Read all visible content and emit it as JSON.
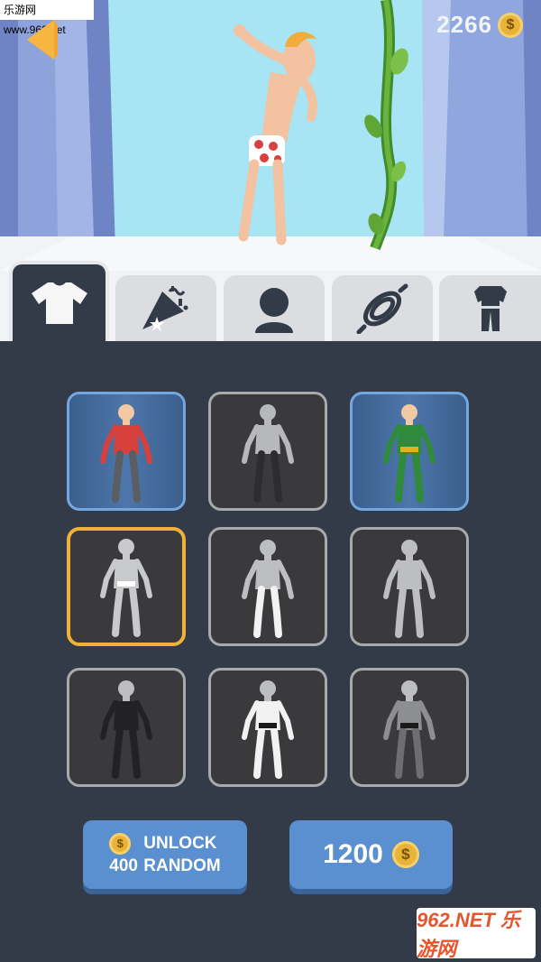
{
  "watermark_top": "乐游网 www.962.net",
  "coins": {
    "amount": "2266",
    "icon": "dollar-coin-icon",
    "symbol": "$"
  },
  "back_icon": "back-arrow-icon",
  "tabs": [
    {
      "name": "shirt",
      "icon": "tshirt-icon",
      "active": true
    },
    {
      "name": "emote",
      "icon": "party-popper-icon",
      "active": false
    },
    {
      "name": "head",
      "icon": "person-head-icon",
      "active": false
    },
    {
      "name": "rope",
      "icon": "rope-coil-icon",
      "active": false
    },
    {
      "name": "suit",
      "icon": "suit-icon",
      "active": false
    }
  ],
  "outfits": [
    {
      "state": "owned",
      "shirt": "#d7403c",
      "legs": "#5a5d62",
      "skin": "#f2c9a3"
    },
    {
      "state": "locked",
      "shirt": "#b7b8ba",
      "legs": "#2d2d30",
      "skin": "#b7b8ba"
    },
    {
      "state": "owned",
      "shirt": "#2f8a3c",
      "legs": "#2f8a3c",
      "skin": "#f2c9a3",
      "accent": "#e3b021"
    },
    {
      "state": "selected",
      "shirt": "#c8c9cb",
      "legs": "#c8c9cb",
      "skin": "#c8c9cb",
      "accent": "#ffffff"
    },
    {
      "state": "locked",
      "shirt": "#bdbec0",
      "legs": "#f2f2f2",
      "skin": "#bdbec0"
    },
    {
      "state": "locked",
      "shirt": "#bdbec0",
      "legs": "#bdbec0",
      "skin": "#bdbec0"
    },
    {
      "state": "locked",
      "shirt": "#222225",
      "legs": "#222225",
      "skin": "#bdbec0"
    },
    {
      "state": "locked",
      "shirt": "#f2f2f2",
      "legs": "#f2f2f2",
      "skin": "#bdbec0",
      "accent": "#1a1a1a"
    },
    {
      "state": "locked",
      "shirt": "#8d8e90",
      "legs": "#6d6e70",
      "skin": "#bdbec0",
      "accent": "#1a1a1a"
    }
  ],
  "unlock_button": {
    "line1": "UNLOCK",
    "amount": "400",
    "line2": "RANDOM",
    "coin_symbol": "$"
  },
  "buy_button": {
    "price": "1200",
    "coin_symbol": "$"
  },
  "watermark_bottom": "962.NET 乐游网",
  "colors": {
    "panel_bg": "#333a48",
    "owned_border": "#74a7df",
    "selected_border": "#f0b13c",
    "button": "#5a8fd0",
    "sky": "#a7e4f4"
  }
}
